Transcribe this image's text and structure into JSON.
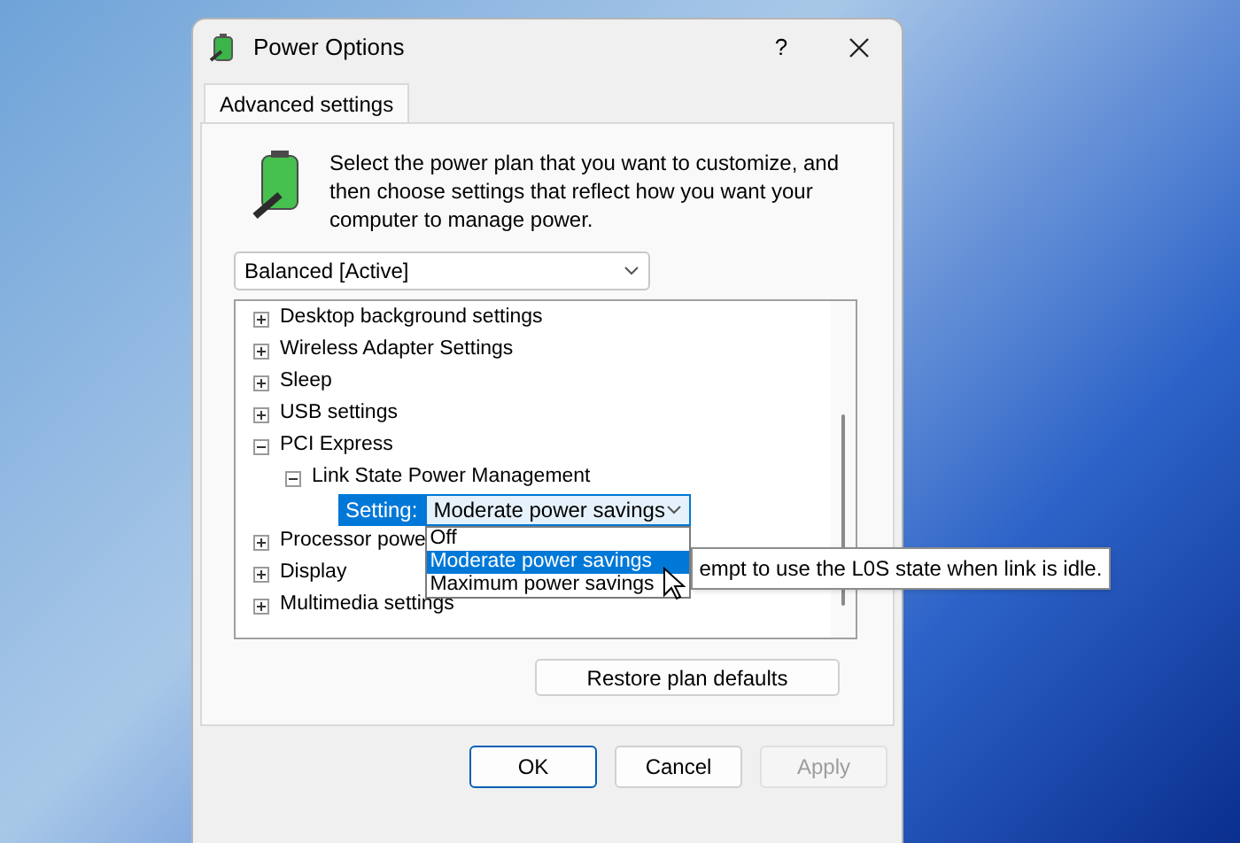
{
  "window": {
    "title": "Power Options",
    "help": "?"
  },
  "tabs": [
    {
      "label": "Advanced settings",
      "selected": true
    }
  ],
  "description": "Select the power plan that you want to customize, and then choose settings that reflect how you want your computer to manage power.",
  "plan_select": {
    "value": "Balanced [Active]"
  },
  "tree": [
    {
      "label": "Desktop background settings",
      "expanded": false
    },
    {
      "label": "Wireless Adapter Settings",
      "expanded": false
    },
    {
      "label": "Sleep",
      "expanded": false
    },
    {
      "label": "USB settings",
      "expanded": false
    },
    {
      "label": "PCI Express",
      "expanded": true,
      "children": [
        {
          "label": "Link State Power Management",
          "expanded": true,
          "children": [
            {
              "kind": "setting",
              "label": "Setting:",
              "value": "Moderate power savings",
              "open": true,
              "options": [
                {
                  "label": "Off",
                  "selected": false
                },
                {
                  "label": "Moderate power savings",
                  "selected": true
                },
                {
                  "label": "Maximum power savings",
                  "selected": false
                }
              ],
              "tooltip": "empt to use the L0S state when link is idle."
            }
          ]
        }
      ]
    },
    {
      "label": "Processor powe",
      "expanded": false
    },
    {
      "label": "Display",
      "expanded": false
    },
    {
      "label": "Multimedia settings",
      "expanded": false
    }
  ],
  "restore_button": "Restore plan defaults",
  "buttons": [
    {
      "label": "OK",
      "disabled": false,
      "default": true
    },
    {
      "label": "Cancel",
      "disabled": false,
      "default": false
    },
    {
      "label": "Apply",
      "disabled": true,
      "default": false
    }
  ]
}
